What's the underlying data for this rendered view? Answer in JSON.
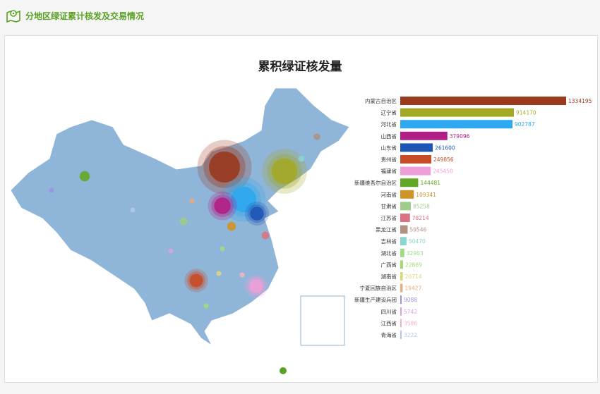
{
  "header": {
    "title": "分地区绿证累计核发及交易情况",
    "icon": "map-pin-icon",
    "accent": "#5aa123"
  },
  "chart_data": {
    "type": "bar",
    "title": "累积绿证核发量",
    "categories": [
      "内蒙古自治区",
      "辽宁省",
      "河北省",
      "山西省",
      "山东省",
      "贵州省",
      "福建省",
      "新疆维吾尔自治区",
      "河南省",
      "甘肃省",
      "江苏省",
      "黑龙江省",
      "吉林省",
      "湖北省",
      "广西省",
      "湖南省",
      "宁夏回族自治区",
      "新疆生产建设兵团",
      "四川省",
      "江西省",
      "青海省"
    ],
    "values": [
      1334195,
      914170,
      902787,
      379096,
      261600,
      249856,
      245450,
      144481,
      109341,
      85258,
      78214,
      59546,
      50470,
      32903,
      22869,
      20714,
      19427,
      9088,
      5742,
      3586,
      3222
    ],
    "colors": [
      "#9a3a1e",
      "#a3a924",
      "#2ea8ee",
      "#b21f86",
      "#1f55b5",
      "#c84d26",
      "#ee9fd7",
      "#63a825",
      "#d09327",
      "#9fcc8c",
      "#db7283",
      "#b19183",
      "#8ad5d0",
      "#9fdb85",
      "#a3d97b",
      "#ddd77b",
      "#e8ab82",
      "#9b92e0",
      "#d3a5e6",
      "#f2b6c0",
      "#b3c7ef"
    ],
    "map": "china-bubble-map"
  }
}
